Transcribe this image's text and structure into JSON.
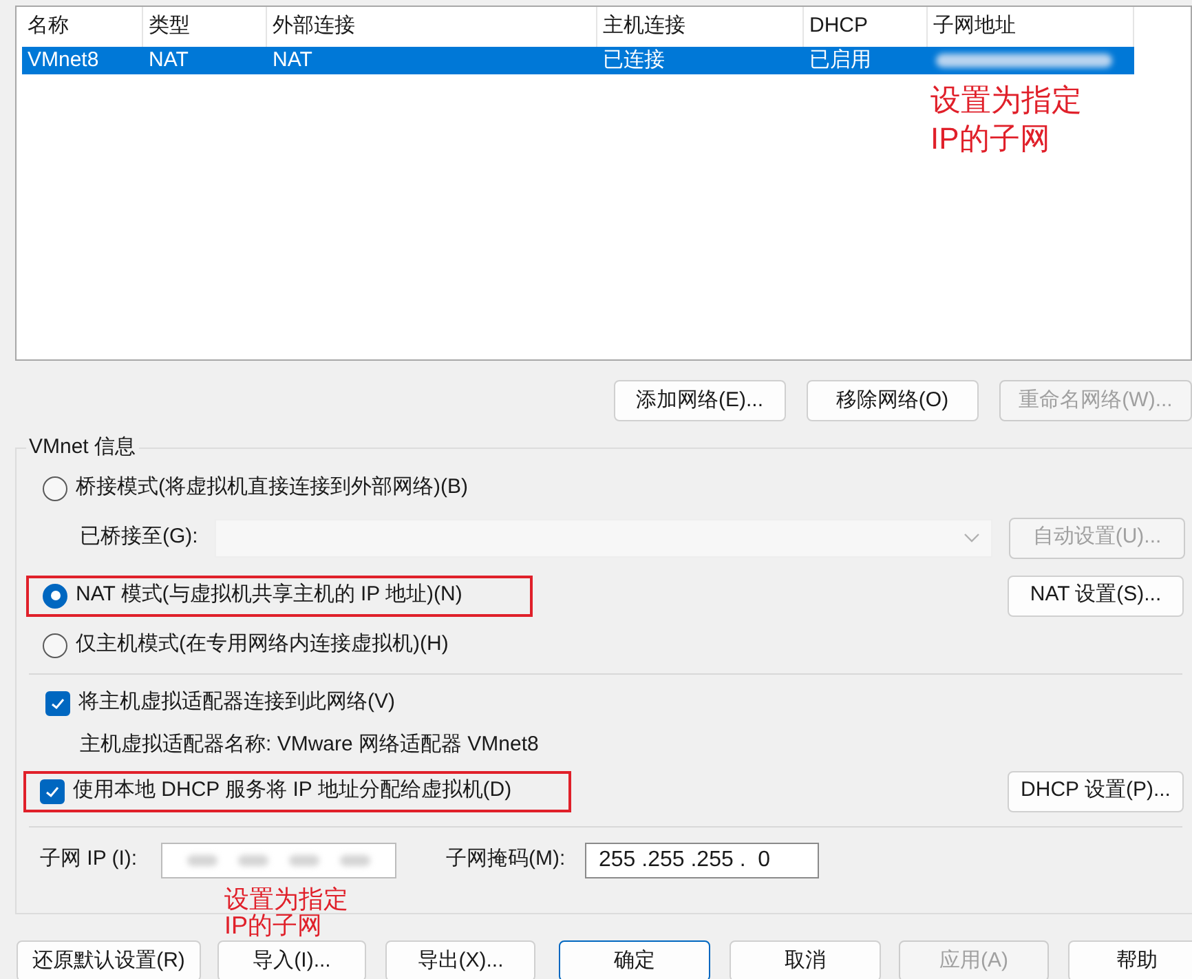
{
  "table": {
    "columns": [
      "名称",
      "类型",
      "外部连接",
      "主机连接",
      "DHCP",
      "子网地址"
    ],
    "rows": [
      {
        "cells": [
          "VMnet8",
          "NAT",
          "NAT",
          "已连接",
          "已启用"
        ],
        "selected": true
      }
    ]
  },
  "network_buttons": [
    {
      "label": "添加网络(E)...",
      "disabled": false
    },
    {
      "label": "移除网络(O)",
      "disabled": false
    },
    {
      "label": "重命名网络(W)...",
      "disabled": true
    }
  ],
  "vmnet_info": {
    "title": "VMnet 信息",
    "bridged_mode": {
      "label": "桥接模式(将虚拟机直接连接到外部网络)(B)",
      "selected": false
    },
    "bridged_to": {
      "label": "已桥接至(G):",
      "disabled": true
    },
    "auto_button": {
      "label": "自动设置(U)...",
      "disabled": true
    },
    "nat_mode": {
      "label": "NAT 模式(与虚拟机共享主机的 IP 地址)(N)",
      "selected": true,
      "highlighted": true
    },
    "nat_button": {
      "label": "NAT 设置(S)..."
    },
    "host_only_mode": {
      "label": "仅主机模式(在专用网络内连接虚拟机)(H)",
      "selected": false
    },
    "connect_adapter": {
      "label": "将主机虚拟适配器连接到此网络(V)",
      "checked": true,
      "highlighted": false
    },
    "adapter_name": "主机虚拟适配器名称: VMware 网络适配器 VMnet8",
    "use_dhcp": {
      "label": "使用本地 DHCP 服务将 IP 地址分配给虚拟机(D)",
      "checked": true,
      "highlighted": true
    },
    "dhcp_button": {
      "label": "DHCP 设置(P)..."
    },
    "subnet_ip": {
      "label": "子网 IP (I):"
    },
    "subnet_mask": {
      "label": "子网掩码(M):",
      "value": "255 .255 .255 .  0"
    }
  },
  "annotations": [
    {
      "text": "设置为指定\nIP的子网"
    },
    {
      "text": "设置为指定\nIP的子网"
    }
  ],
  "dialog_buttons": [
    {
      "label": "还原默认设置(R)",
      "disabled": false,
      "default": false
    },
    {
      "label": "导入(I)...",
      "disabled": false,
      "default": false
    },
    {
      "label": "导出(X)...",
      "disabled": false,
      "default": false
    },
    {
      "label": "确定",
      "disabled": false,
      "default": true
    },
    {
      "label": "取消",
      "disabled": false,
      "default": false
    },
    {
      "label": "应用(A)",
      "disabled": true,
      "default": false
    },
    {
      "label": "帮助",
      "disabled": false,
      "default": false
    }
  ]
}
